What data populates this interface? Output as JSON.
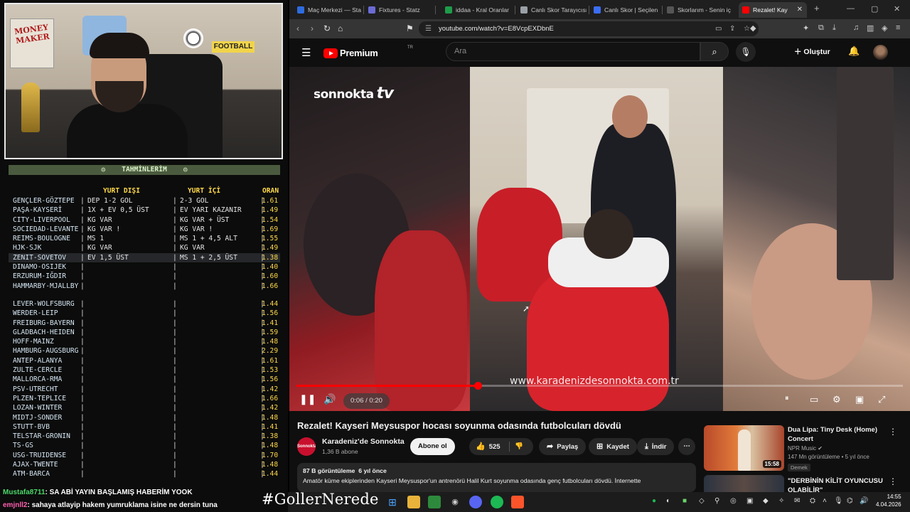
{
  "predictions": {
    "title": "TAHMİNLERİM",
    "title_icon": "target-icon",
    "headers": {
      "domestic": "YURT DIŞI",
      "foreign": "YURT İÇİ",
      "odds": "ORAN"
    },
    "group1": [
      {
        "match": "GENÇLER-GÖZTEPE",
        "a": "DEP 1-2 GOL",
        "b": "2-3 GOL",
        "odds": "1.61"
      },
      {
        "match": "PAŞA-KAYSERİ",
        "a": "1X + EV 0,5 ÜST",
        "b": "EV YARI KAZANIR",
        "odds": "1.49"
      },
      {
        "match": "CITY-LIVERPOOL",
        "a": "KG VAR",
        "b": "KG VAR + ÜST",
        "odds": "1.54"
      },
      {
        "match": "SOCIEDAD-LEVANTE",
        "a": "KG VAR !",
        "b": "KG VAR !",
        "odds": "1.69"
      },
      {
        "match": "REIMS-BOULOGNE",
        "a": "MS 1",
        "b": "MS 1 + 4,5 ALT",
        "odds": "1.55"
      },
      {
        "match": "HJK-SJK",
        "a": "KG VAR",
        "b": "KG VAR",
        "odds": "1.49"
      },
      {
        "match": "ZENIT-SOVETOV",
        "a": "EV 1,5 ÜST",
        "b": "MS 1 + 2,5 ÜST",
        "odds": "1.38",
        "highlight": true
      },
      {
        "match": "DINAMO-OSIJEK",
        "a": "",
        "b": "",
        "odds": "1.40"
      },
      {
        "match": "ERZURUM-IĞDIR",
        "a": "",
        "b": "",
        "odds": "1.60"
      },
      {
        "match": "HAMMARBY-MJALLBY",
        "a": "",
        "b": "",
        "odds": "1.66"
      }
    ],
    "group2": [
      {
        "match": "LEVER-WOLFSBURG",
        "odds": "1.44"
      },
      {
        "match": "WERDER-LEIP",
        "odds": "1.56"
      },
      {
        "match": "FREIBURG-BAYERN",
        "odds": "1.41"
      },
      {
        "match": "GLADBACH-HEIDEN",
        "odds": "1.59"
      },
      {
        "match": "HOFF-MAINZ",
        "odds": "1.48"
      },
      {
        "match": "HAMBURG-AUGSBURG",
        "odds": "2.29"
      },
      {
        "match": "ANTEP-ALANYA",
        "odds": "1.61"
      },
      {
        "match": "ZULTE-CERCLE",
        "odds": "1.53"
      },
      {
        "match": "MALLORCA-RMA",
        "odds": "1.56"
      },
      {
        "match": "PSV-UTRECHT",
        "odds": "1.42"
      },
      {
        "match": "PLZEN-TEPLICE",
        "odds": "1.66"
      },
      {
        "match": "LOZAN-WINTER",
        "odds": "1.42"
      },
      {
        "match": "MIDTJ-SONDER",
        "odds": "1.48"
      },
      {
        "match": "STUTT-BVB",
        "odds": "1.41"
      },
      {
        "match": "TELSTAR-GRONIN",
        "odds": "1.38"
      },
      {
        "match": "TS-GS",
        "odds": "1.48"
      },
      {
        "match": "USG-TRUIDENSE",
        "odds": "1.70"
      },
      {
        "match": "AJAX-TWENTE",
        "odds": "1.48"
      },
      {
        "match": "ATM-BARCA",
        "odds": "1.44"
      }
    ]
  },
  "webcam": {
    "poster_text": "MONEY MAKER",
    "shelf_text": "FOOTBALL"
  },
  "chat": [
    {
      "user": "Mustafa8711",
      "text": ": SA ABİ YAYIN BAŞLAMIŞ HABERİM YOOK"
    },
    {
      "user": "emjnll2",
      "text": ": sahaya atlayip hakem yumruklama isine ne dersin tuna"
    }
  ],
  "browser": {
    "tabs": [
      {
        "label": "Maç Merkezi — Stat",
        "color": "#2d6cdf"
      },
      {
        "label": "Fixtures - Statz",
        "color": "#6b6bd6"
      },
      {
        "label": "iddaa - Kral Oranlar",
        "color": "#1f9c4a"
      },
      {
        "label": "Canlı Skor Tarayıcısı",
        "color": "#9aa0a6"
      },
      {
        "label": "Canlı Skor | Seçilen",
        "color": "#3b6ef5"
      },
      {
        "label": "Skorlarım - Senin iç",
        "color": "#555555"
      },
      {
        "label": "Rezalet! Kay",
        "color": "#ff0000",
        "active": true
      }
    ],
    "url": "youtube.com/watch?v=E8VcpEXDbnE"
  },
  "youtube": {
    "logo_text": "Premium",
    "logo_region": "TR",
    "search_placeholder": "Ara",
    "create_label": "Oluştur",
    "video": {
      "overlay_logo": "sonnokta",
      "overlay_logo_suffix": "tv",
      "watermark": "www.karadenizdesonnokta.com.tr",
      "time": "0:06 / 0:20",
      "progress": 0.3
    },
    "title": "Rezalet! Kayseri Meysuspor hocası soyunma odasında futbolcuları dövdü",
    "channel": {
      "name": "Karadeniz'de Sonnokta",
      "subs": "1,36 B abone",
      "avatar_text": "Sonnokta"
    },
    "subscribe_label": "Abone ol",
    "likes": "525",
    "share_label": "Paylaş",
    "save_label": "Kaydet",
    "download_label": "İndir",
    "description": {
      "views": "87 B görüntüleme",
      "age": "6 yıl önce",
      "text": "Amatör küme ekiplerinden Kayseri Meysuspor'un antrenörü Halil Kurt soyunma odasında genç futbolcuları dövdü. İnternette"
    },
    "recommendations": [
      {
        "title": "Dua Lipa: Tiny Desk (Home) Concert",
        "channel": "NPR Music",
        "meta": "147 Mn görüntüleme • 5 yıl önce",
        "badge": "Demek",
        "duration": "15:58"
      },
      {
        "title": "\"DERBİNİN KİLİT OYUNCUSU OLABİLİR\"",
        "channel": "",
        "meta": "",
        "badge": "",
        "duration": ""
      }
    ]
  },
  "taskbar": {
    "hashtag": "#GollerNerede",
    "time": "14:55",
    "date": "4.04.2026"
  }
}
